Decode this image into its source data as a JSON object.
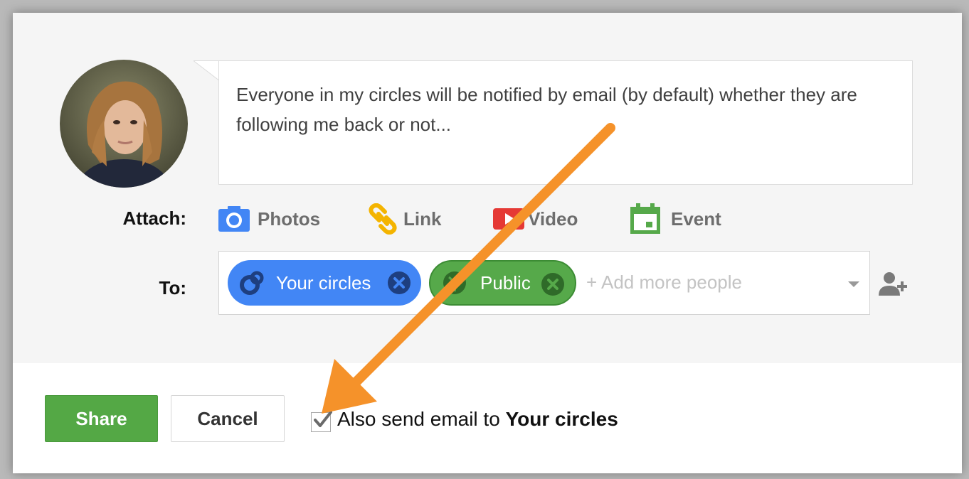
{
  "post": {
    "text": "Everyone in my circles will be notified by email (by default) whether they are following me back or not..."
  },
  "attach": {
    "label": "Attach:",
    "items": [
      {
        "label": "Photos",
        "icon": "camera-icon"
      },
      {
        "label": "Link",
        "icon": "link-icon"
      },
      {
        "label": "Video",
        "icon": "video-icon"
      },
      {
        "label": "Event",
        "icon": "calendar-icon"
      }
    ]
  },
  "to": {
    "label": "To:",
    "chips": [
      {
        "label": "Your circles",
        "icon": "circles-icon",
        "color": "#4286f5"
      },
      {
        "label": "Public",
        "icon": "globe-icon",
        "color": "#56a94a"
      }
    ],
    "placeholder": "+ Add more people"
  },
  "actions": {
    "share_label": "Share",
    "cancel_label": "Cancel",
    "email_checkbox": {
      "checked": true,
      "label_prefix": "Also send email to",
      "label_bold": "Your circles"
    }
  },
  "colors": {
    "share_green": "#54a845",
    "annotation_arrow": "#f5922a"
  }
}
